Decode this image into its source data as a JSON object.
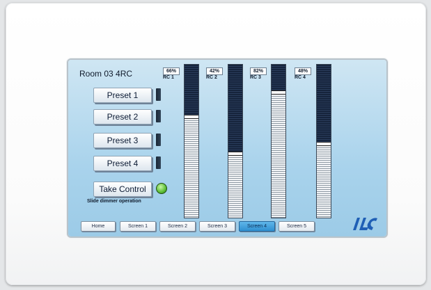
{
  "room_title": "Room 03 4RC",
  "presets": [
    {
      "label": "Preset 1"
    },
    {
      "label": "Preset 2"
    },
    {
      "label": "Preset 3"
    },
    {
      "label": "Preset 4"
    }
  ],
  "take_control": {
    "label": "Take Control",
    "indicator_color": "#5bbd34"
  },
  "hint": "Slide dimmer operation",
  "channels": [
    {
      "name": "RC 1",
      "percent_label": "66%",
      "level": 66
    },
    {
      "name": "RC 2",
      "percent_label": "42%",
      "level": 42
    },
    {
      "name": "RC 3",
      "percent_label": "82%",
      "level": 82
    },
    {
      "name": "RC 4",
      "percent_label": "48%",
      "level": 48
    }
  ],
  "tabs": [
    {
      "label": "Home",
      "active": false
    },
    {
      "label": "Screen 1",
      "active": false
    },
    {
      "label": "Screen 2",
      "active": false
    },
    {
      "label": "Screen 3",
      "active": false
    },
    {
      "label": "Screen 4",
      "active": true
    },
    {
      "label": "Screen 5",
      "active": false
    }
  ],
  "colors": {
    "screen_bg": "#a9d3ec",
    "active_tab": "#2f8fd0",
    "logo": "#1f5fb5"
  },
  "logo": {
    "icon": "ilc-logo-icon"
  }
}
